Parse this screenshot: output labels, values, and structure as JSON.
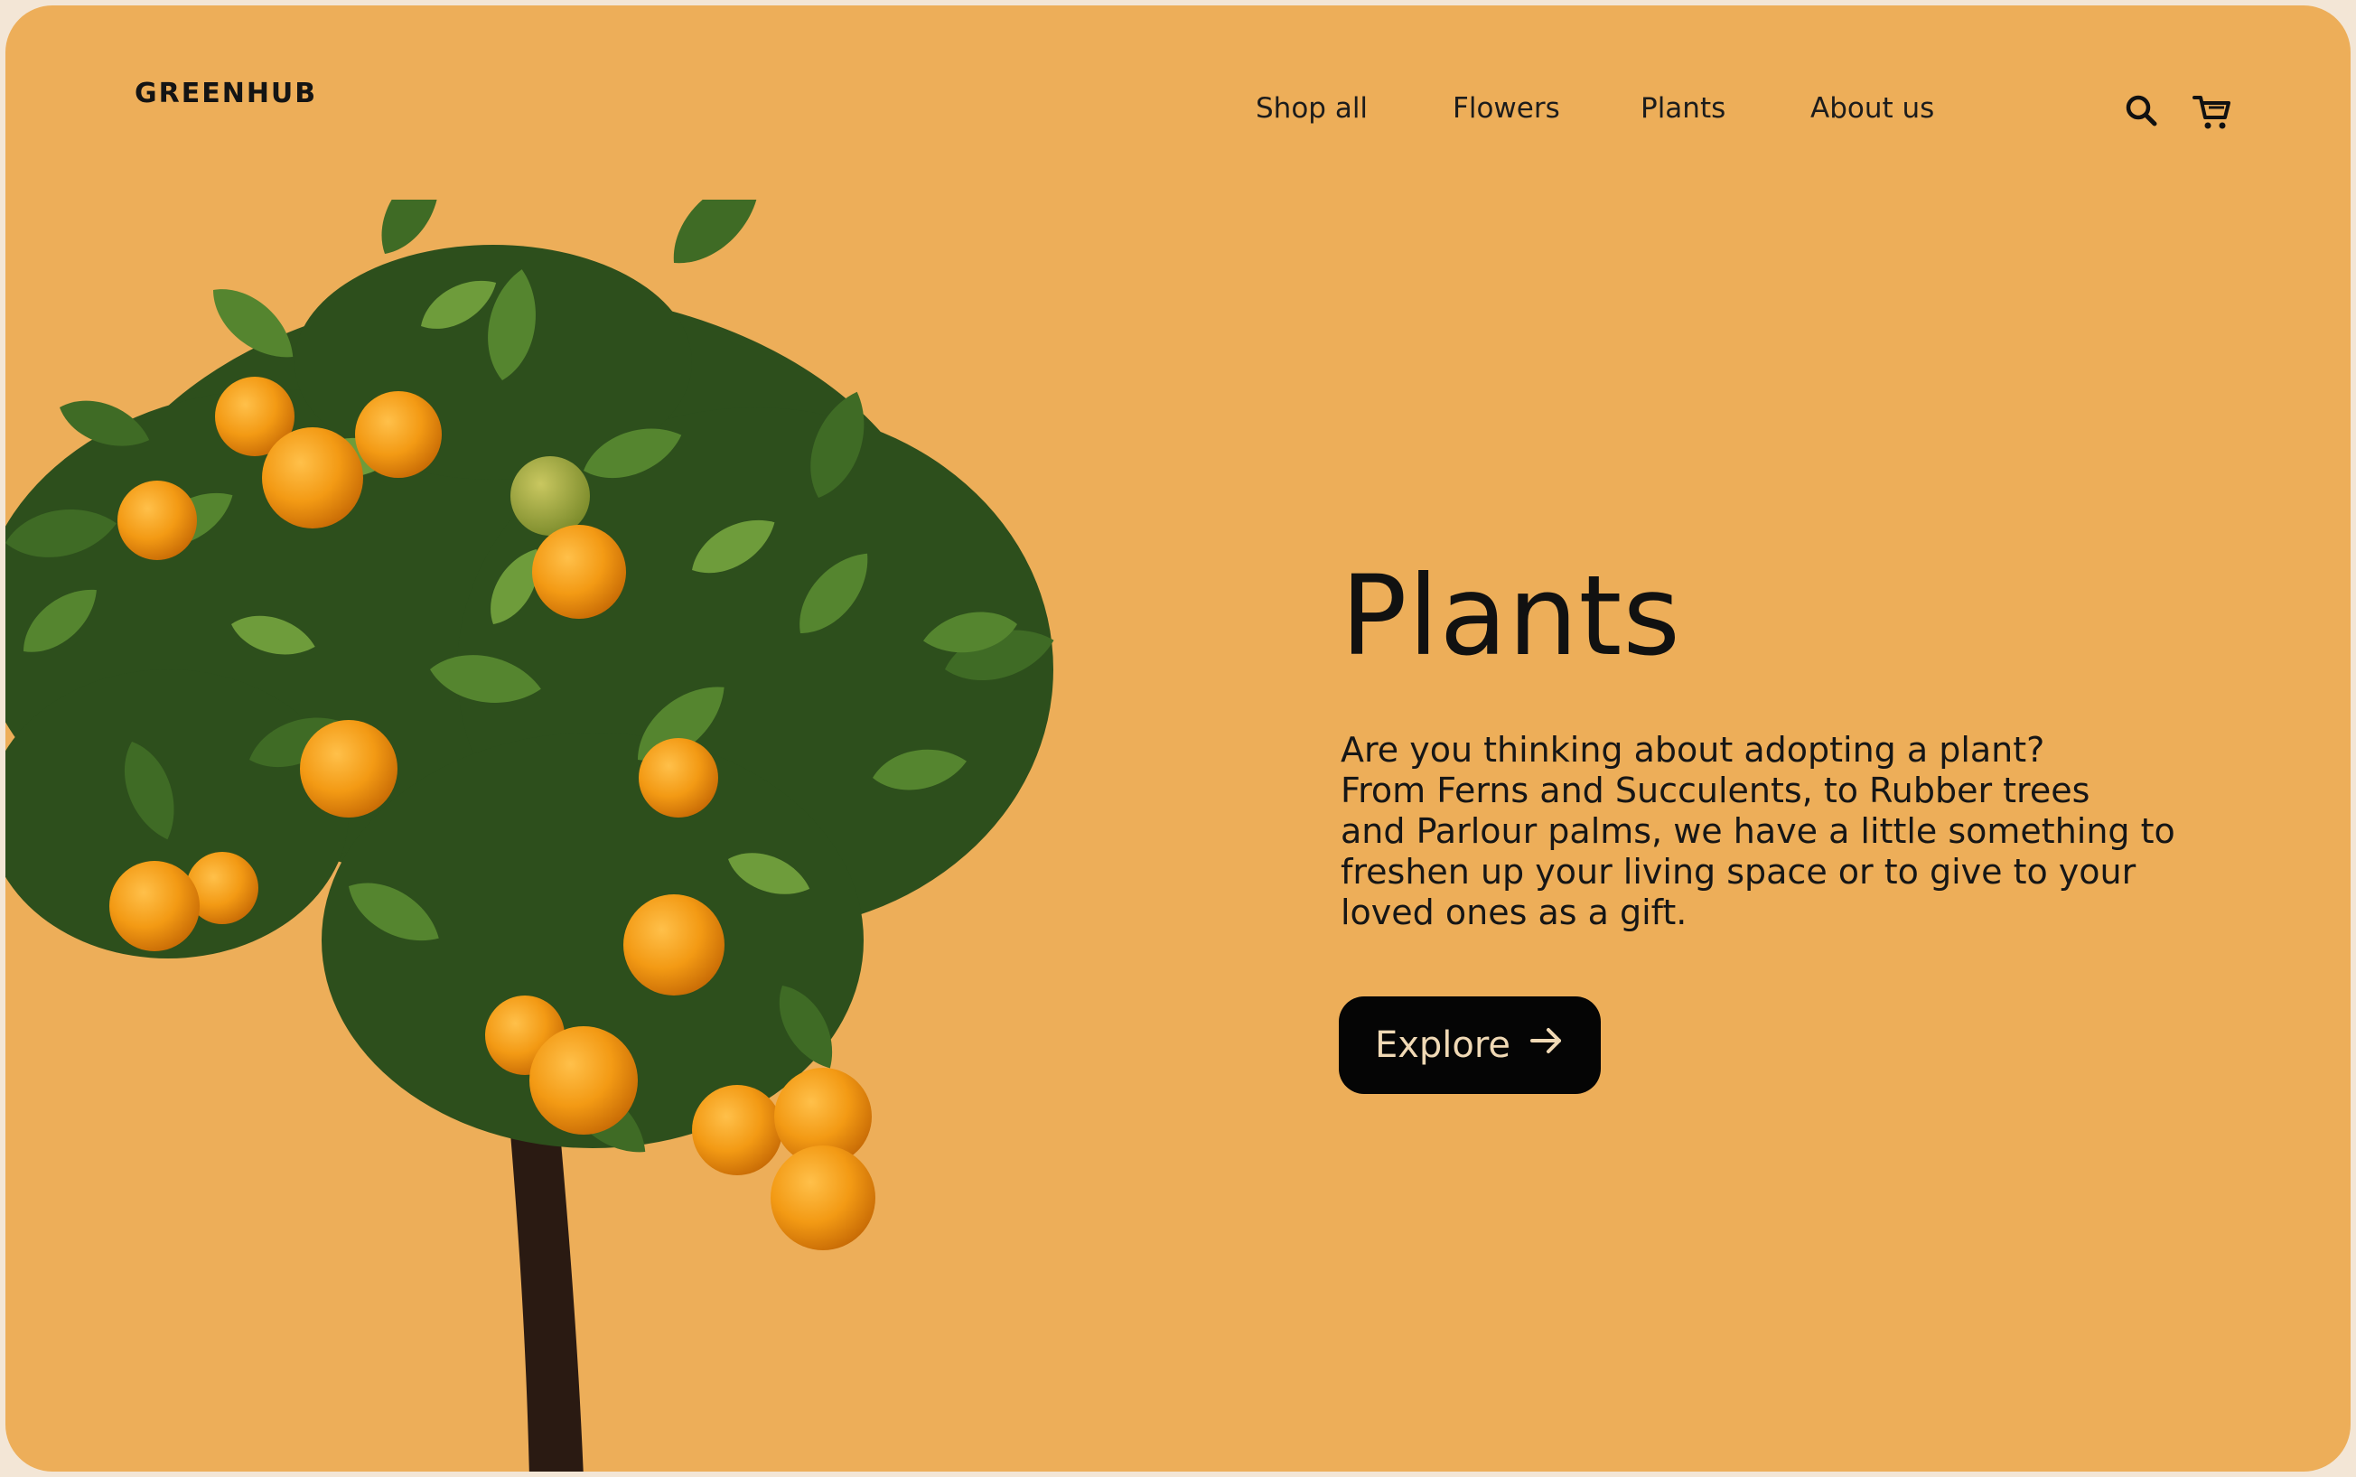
{
  "brand": {
    "logo": "GREENHUB"
  },
  "nav": {
    "items": [
      {
        "label": "Shop all"
      },
      {
        "label": "Flowers"
      },
      {
        "label": "Plants"
      },
      {
        "label": "About us"
      }
    ]
  },
  "icons": {
    "search": "search-icon",
    "cart": "cart-icon",
    "explore_arrow": "arrow-right-icon"
  },
  "hero": {
    "title": "Plants",
    "description_lines": [
      "Are you thinking about adopting a plant?",
      "From Ferns and Succulents, to Rubber trees",
      "and Parlour palms, we have a little something to",
      "freshen up your living space or to give to your",
      "loved ones as a gift."
    ],
    "cta_label": "Explore"
  },
  "colors": {
    "background": "#edae59",
    "text": "#111111",
    "button_bg": "#050505",
    "button_text": "#f0d9b5"
  }
}
